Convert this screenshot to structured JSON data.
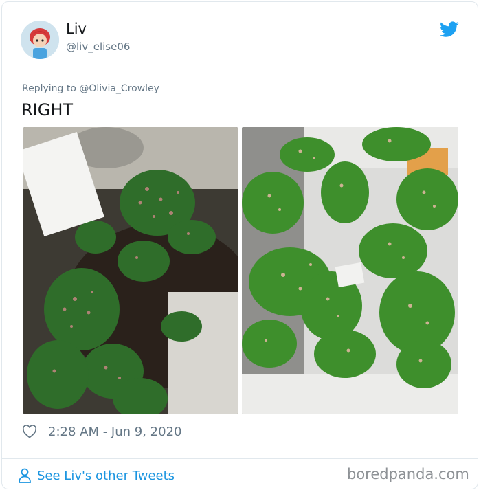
{
  "tweet": {
    "author_name": "Liv",
    "author_handle": "@liv_elise06",
    "replying_to": "Replying to @Olivia_Crowley",
    "text": "RIGHT",
    "timestamp": "2:28 AM - Jun 9, 2020",
    "see_other_label": "See Liv's other Tweets"
  },
  "icons": {
    "brand": "twitter-bird-icon",
    "like": "heart-icon",
    "profile": "person-icon"
  },
  "photos": [
    {
      "description_label": "left-photo"
    },
    {
      "description_label": "right-photo"
    }
  ],
  "watermark": "boredpanda.com",
  "colors": {
    "brand": "#1da1f2",
    "link": "#1b95e0",
    "muted": "#657786",
    "text": "#14171a"
  }
}
